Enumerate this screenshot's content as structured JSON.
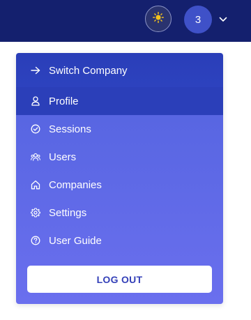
{
  "header": {
    "theme_icon": "sun-icon",
    "avatar_text": "3",
    "chevron_icon": "chevron-down-icon"
  },
  "menu": {
    "items": [
      {
        "label": "Switch Company",
        "icon": "arrow-right-icon"
      },
      {
        "label": "Profile",
        "icon": "user-icon"
      },
      {
        "label": "Sessions",
        "icon": "check-circle-icon"
      },
      {
        "label": "Users",
        "icon": "users-icon"
      },
      {
        "label": "Companies",
        "icon": "home-icon"
      },
      {
        "label": "Settings",
        "icon": "gear-icon"
      },
      {
        "label": "User Guide",
        "icon": "help-circle-icon"
      }
    ],
    "logout_label": "LOG OUT"
  },
  "colors": {
    "topbar": "#14206e",
    "menu_top": "#2a3eb8",
    "menu_bottom": "#6a6fee",
    "logout_text": "#3440b8"
  }
}
